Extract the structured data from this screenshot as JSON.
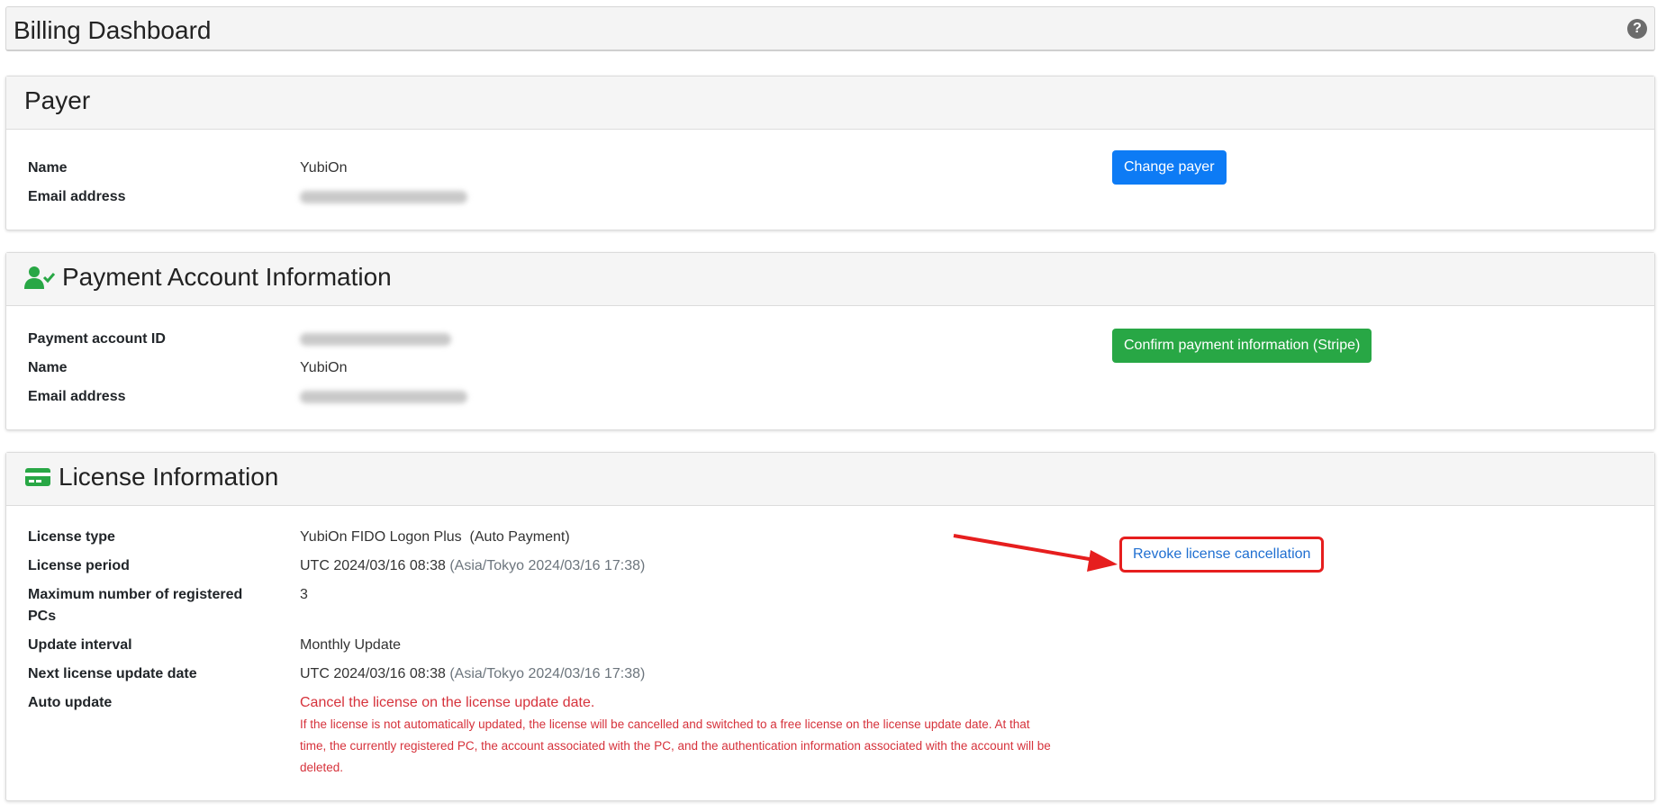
{
  "page": {
    "title": "Billing Dashboard",
    "help_icon": "question-circle-icon"
  },
  "payer": {
    "title": "Payer",
    "name_label": "Name",
    "name_value": "YubiOn",
    "email_label": "Email address",
    "change_button": "Change payer"
  },
  "payment_account": {
    "title": "Payment Account Information",
    "icon": "user-check-icon",
    "id_label": "Payment account ID",
    "name_label": "Name",
    "name_value": "YubiOn",
    "email_label": "Email address",
    "confirm_button": "Confirm payment information (Stripe)"
  },
  "license": {
    "title": "License Information",
    "icon": "credit-card-icon",
    "type_label": "License type",
    "type_value": "YubiOn FIDO Logon Plus  (Auto Payment)",
    "period_label": "License period",
    "period_utc": "UTC 2024/03/16 08:38",
    "period_local": "(Asia/Tokyo 2024/03/16 17:38)",
    "max_pcs_label_1": "Maximum number of registered",
    "max_pcs_label_2": "PCs",
    "max_pcs_value": "3",
    "interval_label": "Update interval",
    "interval_value": "Monthly Update",
    "next_label": "Next license update date",
    "next_utc": "UTC 2024/03/16 08:38",
    "next_local": "(Asia/Tokyo 2024/03/16 17:38)",
    "auto_label": "Auto update",
    "auto_value": "Cancel the license on the license update date.",
    "auto_note_1": "If the license is not automatically updated, the license will be cancelled and switched to a free license on the license update date. At that",
    "auto_note_2": "time, the currently registered PC, the account associated with the PC, and the authentication information associated with the account will be",
    "auto_note_3": "deleted.",
    "revoke_button": "Revoke license cancellation"
  },
  "colors": {
    "primary_button": "#0d7bf5",
    "success_button": "#28a745",
    "danger_text": "#d6323b",
    "highlight": "#e61e1e"
  }
}
